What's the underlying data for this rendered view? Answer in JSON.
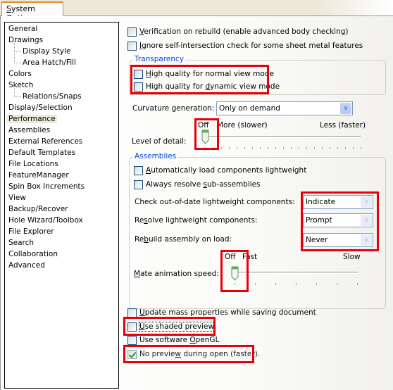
{
  "tab": {
    "label": "System Options",
    "mnemonic": "S",
    "rest": "ystem Options"
  },
  "sidebar": {
    "items": [
      {
        "label": "General",
        "child": false
      },
      {
        "label": "Drawings",
        "child": false
      },
      {
        "label": "Display Style",
        "child": true
      },
      {
        "label": "Area Hatch/Fill",
        "child": true
      },
      {
        "label": "Colors",
        "child": false
      },
      {
        "label": "Sketch",
        "child": false
      },
      {
        "label": "Relations/Snaps",
        "child": true
      },
      {
        "label": "Display/Selection",
        "child": false
      },
      {
        "label": "Performance",
        "child": false,
        "selected": true
      },
      {
        "label": "Assemblies",
        "child": false
      },
      {
        "label": "External References",
        "child": false
      },
      {
        "label": "Default Templates",
        "child": false
      },
      {
        "label": "File Locations",
        "child": false
      },
      {
        "label": "FeatureManager",
        "child": false
      },
      {
        "label": "Spin Box Increments",
        "child": false
      },
      {
        "label": "View",
        "child": false
      },
      {
        "label": "Backup/Recover",
        "child": false
      },
      {
        "label": "Hole Wizard/Toolbox",
        "child": false
      },
      {
        "label": "File Explorer",
        "child": false
      },
      {
        "label": "Search",
        "child": false
      },
      {
        "label": "Collaboration",
        "child": false
      },
      {
        "label": "Advanced",
        "child": false
      }
    ]
  },
  "options": {
    "verification": {
      "m": "V",
      "rest": "erification on rebuild (enable advanced body checking)",
      "checked": false
    },
    "ignore_self_intersection": {
      "m": "I",
      "rest": "gnore self-intersection check for some sheet metal features",
      "checked": false
    },
    "transparency": {
      "label": "Transparency",
      "normal": {
        "m": "H",
        "rest": "igh quality for normal view mode",
        "checked": false
      },
      "dynamic": {
        "pre": "High quality for ",
        "m": "d",
        "rest": "ynamic view mode",
        "checked": false
      }
    },
    "curvature": {
      "label": "Curvature generation:",
      "value": "Only on demand"
    },
    "level_of_detail": {
      "label": "Level of detail:",
      "off_label": "Off",
      "more_label": "More (slower)",
      "less_label": "Less (faster)",
      "value": 0
    },
    "assemblies": {
      "label": "Assemblies",
      "auto_lightweight": {
        "m": "A",
        "rest": "utomatically load components lightweight",
        "checked": false
      },
      "always_resolve": {
        "pre": "Always resolve ",
        "m": "s",
        "rest": "ub-assemblies",
        "checked": false
      },
      "check_out_of_date": {
        "label": "Check out-of-date lightweight components:",
        "value": "Indicate"
      },
      "resolve_lightweight": {
        "pre": "Re",
        "m": "s",
        "rest": "olve lightweight components:",
        "value": "Prompt"
      },
      "rebuild_on_load": {
        "pre": "Re",
        "m": "b",
        "rest": "uild assembly on load:",
        "value": "Never"
      },
      "mate_animation": {
        "m": "M",
        "rest": "ate animation speed:",
        "off_label": "Off",
        "fast_label": "Fast",
        "slow_label": "Slow",
        "value": 0
      }
    },
    "update_mass": {
      "m": "U",
      "rest": "pdate mass properties while saving document",
      "checked": false
    },
    "shaded_preview": {
      "m": "U",
      "rest": "se shaded preview",
      "checked": false
    },
    "software_opengl": {
      "pre": "Use software ",
      "m": "O",
      "rest": "penGL",
      "checked": false
    },
    "no_preview": {
      "pre": "No previe",
      "m": "w",
      "rest": " during open (faster).",
      "checked": true
    }
  },
  "colors": {
    "highlight": "#e8000b",
    "group_label": "#0046d5",
    "tab_accent": "#e68b2c"
  }
}
